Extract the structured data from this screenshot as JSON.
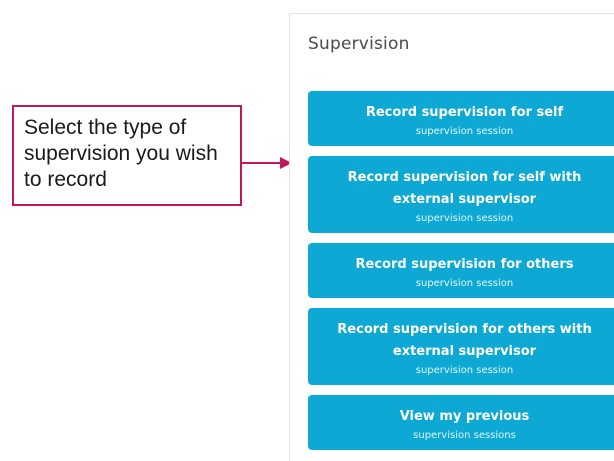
{
  "callout": {
    "text": "Select the type of supervision you wish to record",
    "border_color": "#c2185b"
  },
  "panel": {
    "title": "Supervision",
    "accent_color": "#0da9d4",
    "buttons": [
      {
        "label": "Record supervision for self",
        "sublabel": "supervision session"
      },
      {
        "label": "Record supervision for self with external supervisor",
        "sublabel": "supervision session"
      },
      {
        "label": "Record supervision for others",
        "sublabel": "supervision session"
      },
      {
        "label": "Record supervision for others with external supervisor",
        "sublabel": "supervision session"
      },
      {
        "label": "View my previous",
        "sublabel": "supervision sessions"
      }
    ]
  }
}
